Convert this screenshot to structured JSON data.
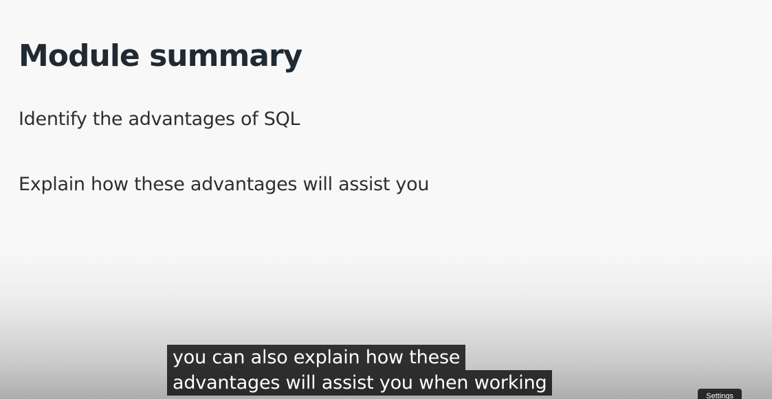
{
  "slide": {
    "title": "Module summary",
    "bullets": [
      "Identify the advantages of SQL",
      "Explain how these advantages will assist you"
    ]
  },
  "captions": {
    "lines": [
      "you can also explain how these",
      "advantages will assist you when working"
    ]
  },
  "tooltip": {
    "label": "Settings"
  },
  "colors": {
    "title_text": "#1f2a33",
    "body_text": "#2b2f33",
    "caption_bg": "#080808",
    "caption_text": "#ffffff"
  }
}
